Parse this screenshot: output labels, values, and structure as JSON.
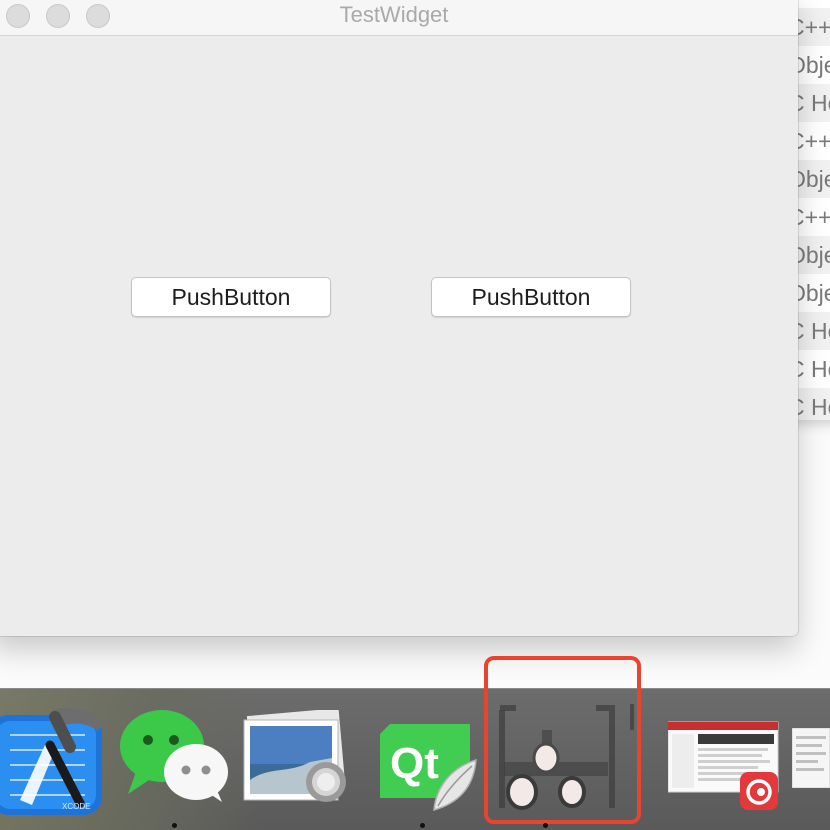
{
  "window": {
    "title": "TestWidget",
    "buttons": [
      {
        "label": "PushButton"
      },
      {
        "label": "PushButton"
      }
    ]
  },
  "background_window": {
    "rows": [
      "C++",
      "Obje",
      "C He",
      "C++",
      "Obje",
      "C++",
      "Obje",
      "Obje",
      "C He",
      "C He",
      "C He"
    ]
  },
  "dock": {
    "apps": [
      {
        "name": "Xcode",
        "icon": "xcode-icon",
        "badge": "XCODE"
      },
      {
        "name": "WeChat",
        "icon": "wechat-icon"
      },
      {
        "name": "Preview",
        "icon": "preview-icon"
      },
      {
        "name": "Qt Creator",
        "icon": "qt-creator-icon",
        "label": "Qt"
      },
      {
        "name": "TestWidget",
        "icon": "app-placeholder-icon"
      },
      {
        "name": "NetEase Music",
        "icon": "netease-music-icon"
      }
    ]
  },
  "colors": {
    "window_bg": "#ececec",
    "selection_highlight": "#e8442f",
    "qt_green": "#41cd52"
  }
}
